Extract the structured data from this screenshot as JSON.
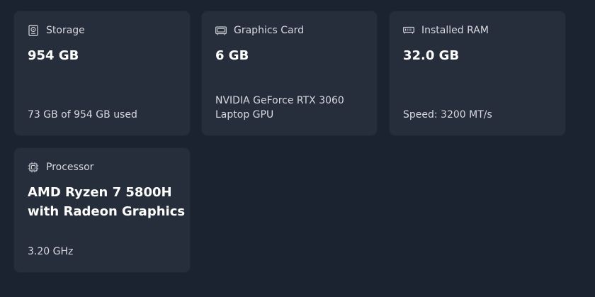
{
  "storage": {
    "icon": "hard-drive-icon",
    "title": "Storage",
    "value": "954 GB",
    "detail": "73 GB of 954 GB used"
  },
  "graphics": {
    "icon": "graphics-card-icon",
    "title": "Graphics Card",
    "value": "6 GB",
    "detail_line1": "NVIDIA GeForce RTX 3060",
    "detail_line2": "Laptop GPU"
  },
  "ram": {
    "icon": "memory-module-icon",
    "title": "Installed RAM",
    "value": "32.0 GB",
    "detail": "Speed: 3200 MT/s"
  },
  "processor": {
    "icon": "processor-chip-icon",
    "title": "Processor",
    "value_line1": "AMD Ryzen 7 5800H",
    "value_line2": "with Radeon Graphics",
    "detail": "3.20 GHz"
  },
  "colors": {
    "background": "#1c2330",
    "card": "#262d3b",
    "text_primary": "#ffffff",
    "text_secondary": "#d7dae0"
  }
}
